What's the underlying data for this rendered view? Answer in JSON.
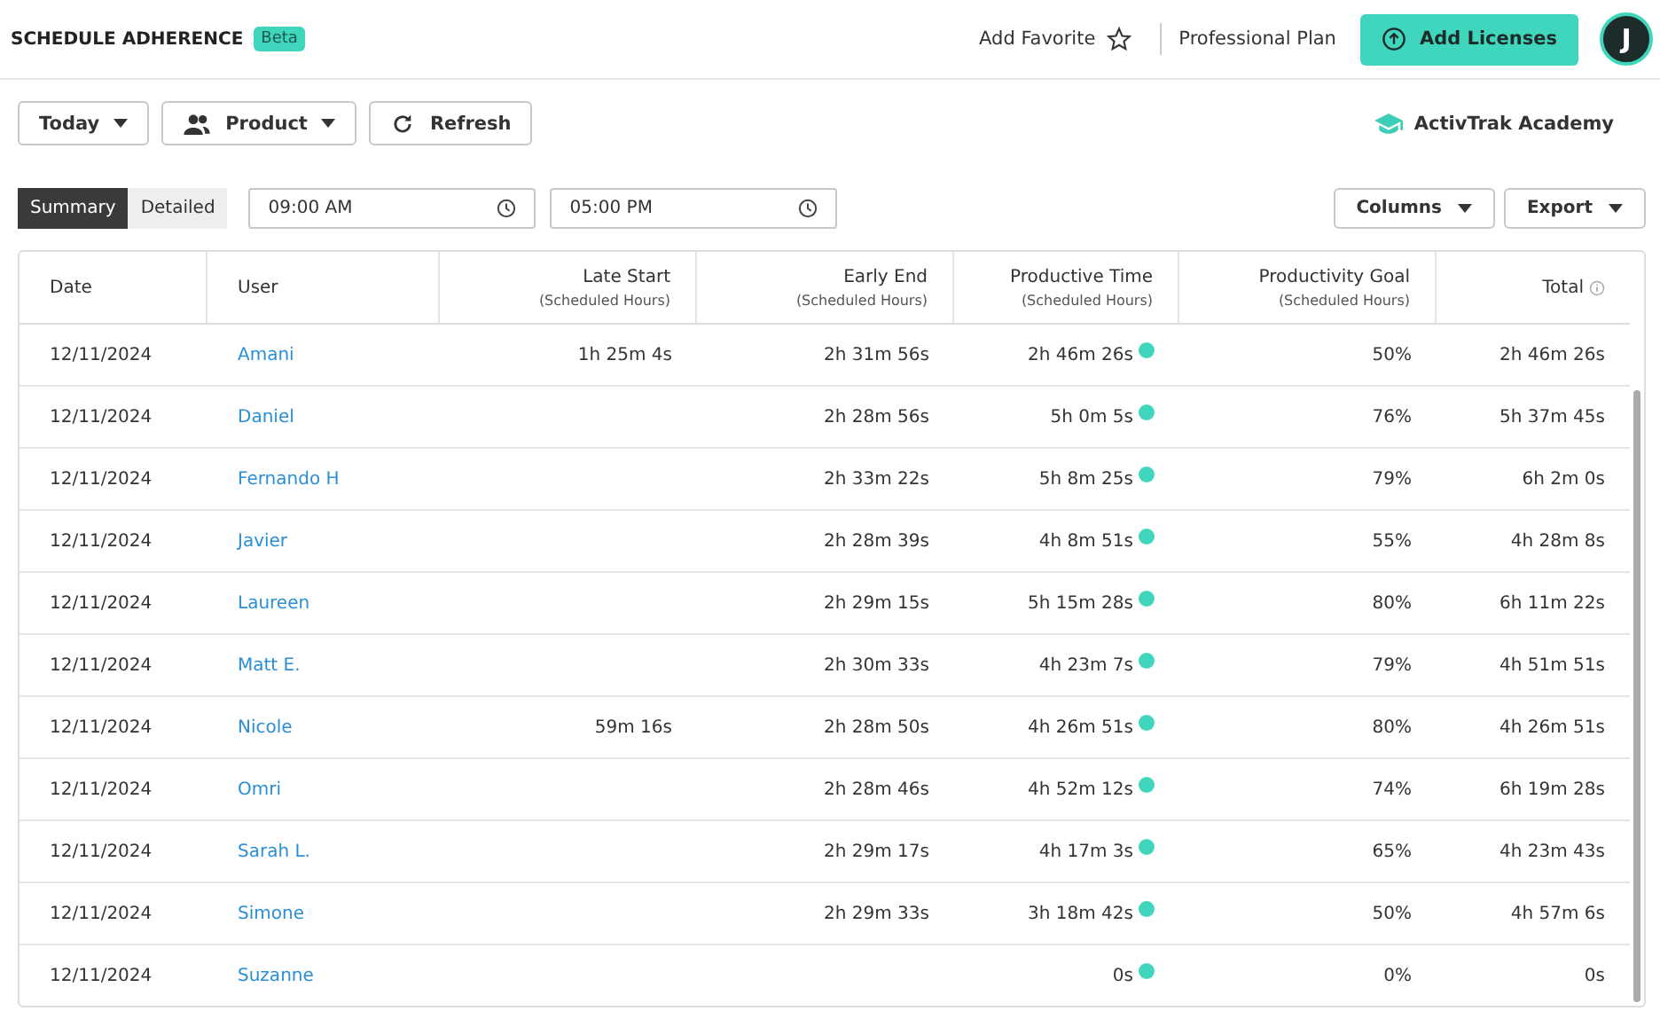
{
  "header": {
    "title": "SCHEDULE ADHERENCE",
    "badge": "Beta",
    "favorite": "Add Favorite",
    "plan": "Professional Plan",
    "add_button": "Add Licenses",
    "avatar": "J"
  },
  "toolbar": {
    "buttons": [
      {
        "label": "Today",
        "kind": "dropdown"
      },
      {
        "label": "Product",
        "kind": "people"
      },
      {
        "label": "Refresh",
        "kind": "refresh"
      }
    ],
    "academy": "ActivTrak Academy"
  },
  "view_toggle": [
    {
      "label": "Summary",
      "selected": true
    },
    {
      "label": "Detailed",
      "selected": false
    }
  ],
  "time_fields": [
    {
      "value": "09:00 AM"
    },
    {
      "value": "05:00 PM"
    }
  ],
  "actions": [
    "Columns",
    "Export"
  ],
  "table": {
    "columns": [
      {
        "title": "Date"
      },
      {
        "title": "User"
      },
      {
        "title": "Late Start",
        "subtitle": "(Scheduled Hours)"
      },
      {
        "title": "Early End",
        "subtitle": "(Scheduled Hours)"
      },
      {
        "title": "Productive Time",
        "subtitle": "(Scheduled Hours)"
      },
      {
        "title": "Productivity Goal",
        "subtitle": "(Scheduled Hours)"
      },
      {
        "title": "Total",
        "info": true
      }
    ],
    "rows": [
      [
        "12/11/2024",
        "Amani",
        "1h 25m 4s",
        "2h 31m 56s",
        "2h 46m 26s",
        "50%",
        "2h 46m 26s"
      ],
      [
        "12/11/2024",
        "Daniel",
        "",
        "2h 28m 56s",
        "5h 0m 5s",
        "76%",
        "5h 37m 45s"
      ],
      [
        "12/11/2024",
        "Fernando H",
        "",
        "2h 33m 22s",
        "5h 8m 25s",
        "79%",
        "6h 2m 0s"
      ],
      [
        "12/11/2024",
        "Javier",
        "",
        "2h 28m 39s",
        "4h 8m 51s",
        "55%",
        "4h 28m 8s"
      ],
      [
        "12/11/2024",
        "Laureen",
        "",
        "2h 29m 15s",
        "5h 15m 28s",
        "80%",
        "6h 11m 22s"
      ],
      [
        "12/11/2024",
        "Matt E.",
        "",
        "2h 30m 33s",
        "4h 23m 7s",
        "79%",
        "4h 51m 51s"
      ],
      [
        "12/11/2024",
        "Nicole",
        "59m 16s",
        "2h 28m 50s",
        "4h 26m 51s",
        "80%",
        "4h 26m 51s"
      ],
      [
        "12/11/2024",
        "Omri",
        "",
        "2h 28m 46s",
        "4h 52m 12s",
        "74%",
        "6h 19m 28s"
      ],
      [
        "12/11/2024",
        "Sarah L.",
        "",
        "2h 29m 17s",
        "4h 17m 3s",
        "65%",
        "4h 23m 43s"
      ],
      [
        "12/11/2024",
        "Simone",
        "",
        "2h 29m 33s",
        "3h 18m 42s",
        "50%",
        "4h 57m 6s"
      ],
      [
        "12/11/2024",
        "Suzanne",
        "",
        "",
        "0s",
        "0%",
        "0s"
      ]
    ]
  }
}
